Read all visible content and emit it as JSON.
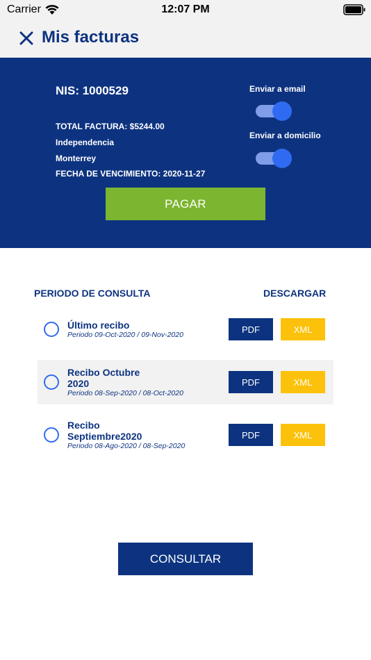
{
  "status_bar": {
    "carrier": "Carrier",
    "time": "12:07 PM",
    "wifi_icon": "wifi-icon",
    "battery_icon": "battery-icon"
  },
  "header": {
    "title": "Mis facturas",
    "close_icon": "close-icon"
  },
  "bill": {
    "nis": "NIS: 1000529",
    "total": "TOTAL FACTURA: $5244.00",
    "neighborhood": "Independencia",
    "city": "Monterrey",
    "due_date": "FECHA DE VENCIMIENTO: 2020-11-27",
    "email_toggle_label": "Enviar a email",
    "email_toggle_on": true,
    "home_toggle_label": "Enviar a domicilio",
    "home_toggle_on": true,
    "pay_label": "PAGAR"
  },
  "query": {
    "period_header": "PERIODO DE CONSULTA",
    "download_header": "DESCARGAR",
    "receipts": [
      {
        "title": "Último recibo",
        "period": "Periodo 09-Oct-2020 / 09-Nov-2020",
        "pdf_label": "PDF",
        "xml_label": "XML",
        "selected": false
      },
      {
        "title": "Recibo Octubre 2020",
        "period": "Periodo 08-Sep-2020 / 08-Oct-2020",
        "pdf_label": "PDF",
        "xml_label": "XML",
        "selected": false
      },
      {
        "title": "Recibo Septiembre2020",
        "period": "Periodo 08-Ago-2020 / 08-Sep-2020",
        "pdf_label": "PDF",
        "xml_label": "XML",
        "selected": false
      }
    ],
    "consult_label": "CONSULTAR"
  },
  "colors": {
    "primary": "#0d3380",
    "pay_green": "#7cb52f",
    "xml_yellow": "#fcc10a",
    "toggle_blue": "#2f6bf2",
    "row_alt": "#f2f2f2"
  }
}
